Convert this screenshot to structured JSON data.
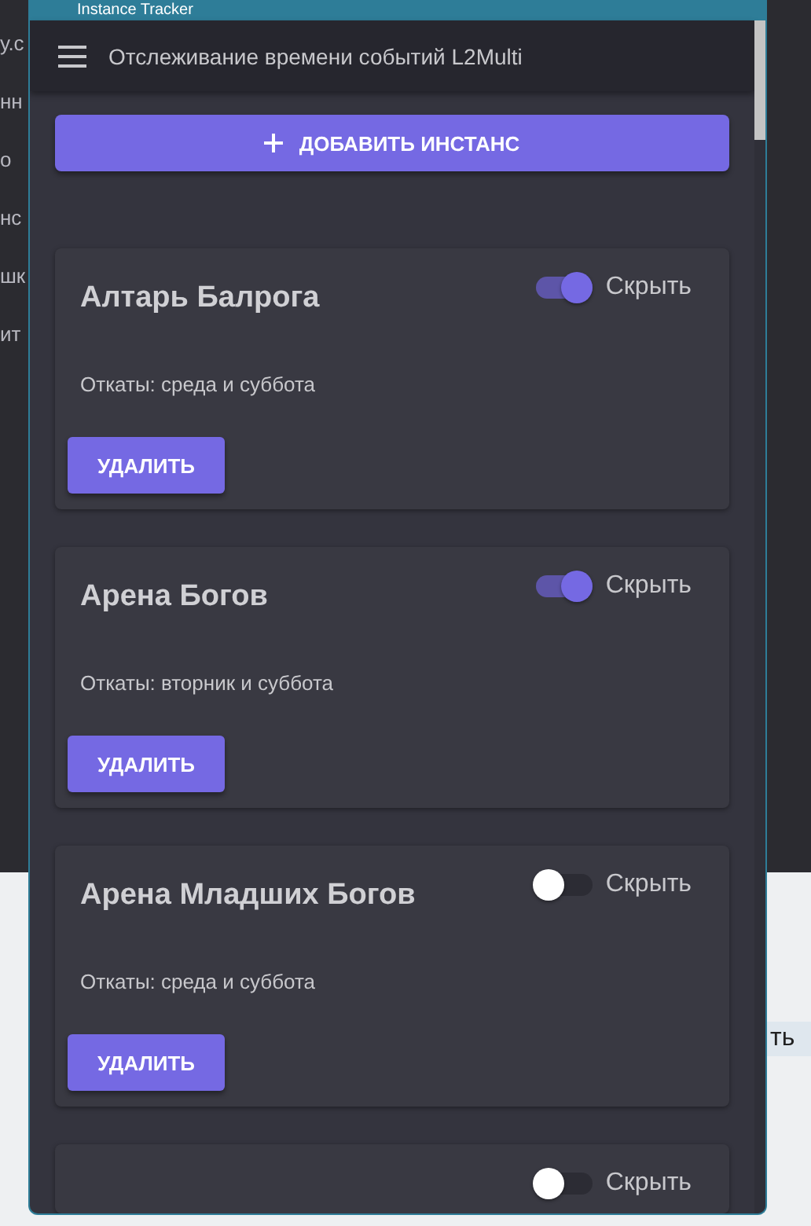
{
  "window": {
    "title": "Instance Tracker"
  },
  "background": {
    "left_fragments": [
      "у.с",
      "нн",
      "о",
      "нс",
      "шк",
      "ит"
    ],
    "right_fragment": "ть"
  },
  "app_bar": {
    "title": "Отслеживание времени событий L2Multi"
  },
  "add_button": {
    "label": "ДОБАВИТЬ ИНСТАНС"
  },
  "instances": [
    {
      "name": "Алтарь Балрога",
      "hidden": true,
      "hide_label": "Скрыть",
      "resets": "Откаты: среда и суббота",
      "delete_label": "УДАЛИТЬ"
    },
    {
      "name": "Арена Богов",
      "hidden": true,
      "hide_label": "Скрыть",
      "resets": "Откаты: вторник и суббота",
      "delete_label": "УДАЛИТЬ"
    },
    {
      "name": "Арена Младших Богов",
      "hidden": false,
      "hide_label": "Скрыть",
      "resets": "Откаты: среда и суббота",
      "delete_label": "УДАЛИТЬ"
    },
    {
      "hidden": false,
      "hide_label": "Скрыть"
    }
  ]
}
